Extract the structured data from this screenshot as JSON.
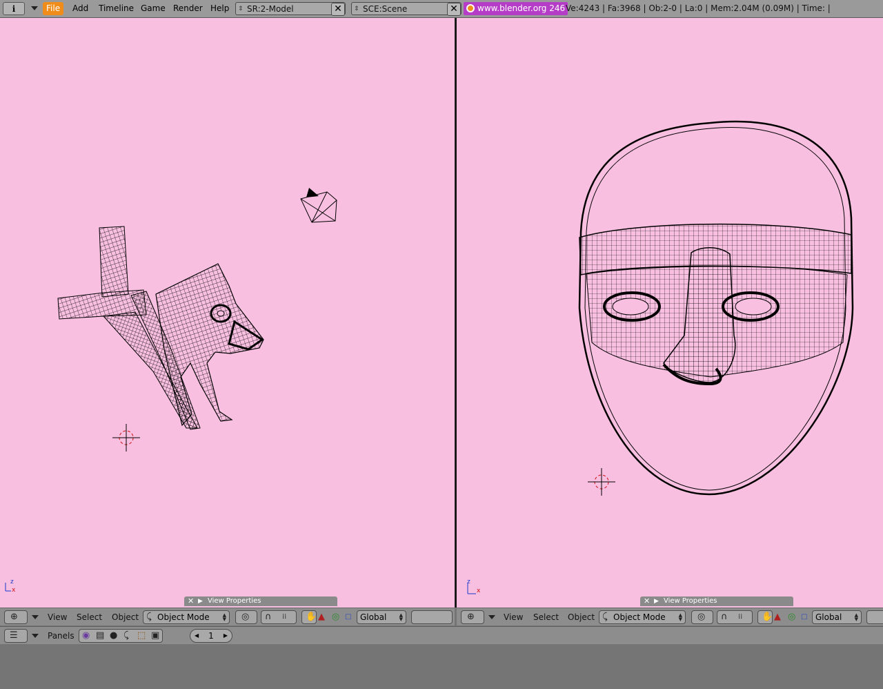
{
  "topbar": {
    "info_icon": "i",
    "menus": [
      "File",
      "Add",
      "Timeline",
      "Game",
      "Render",
      "Help"
    ],
    "screen_browse": "SR:2-Model",
    "scene_browse": "SCE:Scene",
    "blender_link": "www.blender.org 246",
    "stats": "Ve:4243 | Fa:3968 | Ob:2-0 | La:0  | Mem:2.04M (0.09M)  | Time: |"
  },
  "viewport_left": {
    "props_label": "View Properties",
    "axis_labels": [
      "z",
      "x"
    ]
  },
  "viewport_right": {
    "props_label": "View Properties",
    "axis_labels": [
      "z",
      "x"
    ]
  },
  "view_header_left": {
    "menus": [
      "View",
      "Select",
      "Object"
    ],
    "mode": "Object Mode",
    "orientation": "Global"
  },
  "view_header_right": {
    "menus": [
      "View",
      "Select",
      "Object"
    ],
    "mode": "Object Mode",
    "orientation": "Global"
  },
  "buttons_header": {
    "panels_label": "Panels",
    "frame_value": "1",
    "frame_left_arrow": "◀",
    "frame_right_arrow": "▶"
  },
  "colors": {
    "viewport_bg": "#f8bfe0",
    "active_menu": "#f08c1a",
    "blender_link_bg": "#b43cc6"
  }
}
